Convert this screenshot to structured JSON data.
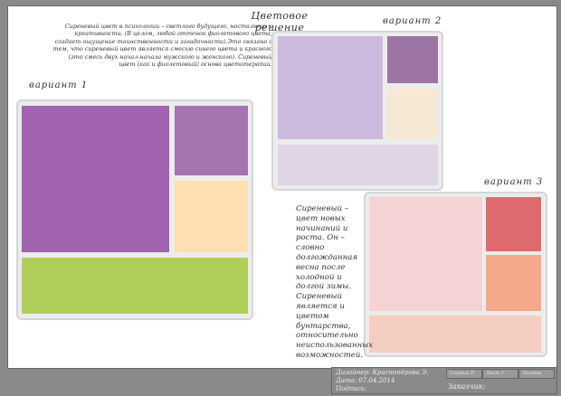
{
  "page": {
    "title": "Цветовое решение",
    "paragraph_1": "Сиреневый цвет в психологии – светлого будущего, ностальгии и креативности. (В целом, любой оттенок фиолетового цвета, создает ощущение таинственности и загадочности).Это связано с тем, что сиреневый цвет является смесью синего цвета и красного (это смесь двух начал-начала мужского и женского). Сиреневый цвет (как и фиолетовый) основа цветотерапии.",
    "paragraph_2": "Сиреневый – цвет новых начинаний и роста. Он – словно долгожданная весна после холодной и долгой зимы. Сиреневый является и цветом бунтарства, относительно неиспользованных возможностей."
  },
  "variants": [
    {
      "label": "вариант 1",
      "colors": [
        "#a162b0",
        "#a573b0",
        "#ffdfb2",
        "#b0cf58"
      ]
    },
    {
      "label": "вариант 2",
      "colors": [
        "#cbbadd",
        "#9c75a4",
        "#f5e8d5",
        "#e0d5e4"
      ]
    },
    {
      "label": "вариант 3",
      "colors": [
        "#f5d3d4",
        "#e06b6f",
        "#f5a98b",
        "#f5cec2"
      ]
    }
  ],
  "stamp": {
    "designer": "Дизайнер: Краснопёрова Э.",
    "date": "Дата: 07.04.2014",
    "signature": "Подпись:",
    "stage": "Стадия П",
    "sheet": "Лист 1",
    "sheets": "Листов",
    "customer": "Заказчик:"
  }
}
